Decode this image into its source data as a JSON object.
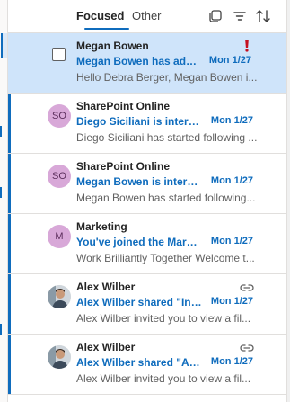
{
  "header": {
    "tabs": [
      {
        "label": "Focused",
        "active": true
      },
      {
        "label": "Other",
        "active": false
      }
    ]
  },
  "messages": [
    {
      "sender": "Megan Bowen",
      "subject": "Megan Bowen has adde...",
      "date": "Mon 1/27",
      "preview": "Hello Debra Berger, Megan Bowen i...",
      "avatar": null,
      "selected": true,
      "important": true,
      "link": false
    },
    {
      "sender": "SharePoint Online",
      "subject": "Diego Siciliani is interest...",
      "date": "Mon 1/27",
      "preview": "Diego Siciliani has started following ...",
      "avatar": "SO",
      "avatar_color": "#d8a8d8",
      "selected": false,
      "important": false,
      "link": false
    },
    {
      "sender": "SharePoint Online",
      "subject": "Megan Bowen is interes...",
      "date": "Mon 1/27",
      "preview": "Megan Bowen has started following...",
      "avatar": "SO",
      "avatar_color": "#d8a8d8",
      "selected": false,
      "important": false,
      "link": false
    },
    {
      "sender": "Marketing",
      "subject": "You've joined the Marke...",
      "date": "Mon 1/27",
      "preview": "Work Brilliantly Together Welcome t...",
      "avatar": "M",
      "avatar_color": "#d8a8d8",
      "selected": false,
      "important": false,
      "link": false
    },
    {
      "sender": "Alex Wilber",
      "subject": "Alex Wilber shared \"Inc...",
      "date": "Mon 1/27",
      "preview": "Alex Wilber invited you to view a fil...",
      "avatar": "photo",
      "selected": false,
      "important": false,
      "link": true
    },
    {
      "sender": "Alex Wilber",
      "subject": "Alex Wilber shared \"Ad ...",
      "date": "Mon 1/27",
      "preview": "Alex Wilber invited you to view a fil...",
      "avatar": "photo",
      "selected": false,
      "important": false,
      "link": true
    }
  ],
  "colors": {
    "accent": "#0f6cbd",
    "selected_bg": "#cfe4fa",
    "important": "#c50f1f"
  },
  "icons": {
    "select_all": "select-all-icon",
    "filter": "filter-icon",
    "sort": "sort-icon",
    "important": "exclamation-icon",
    "link": "link-icon"
  }
}
